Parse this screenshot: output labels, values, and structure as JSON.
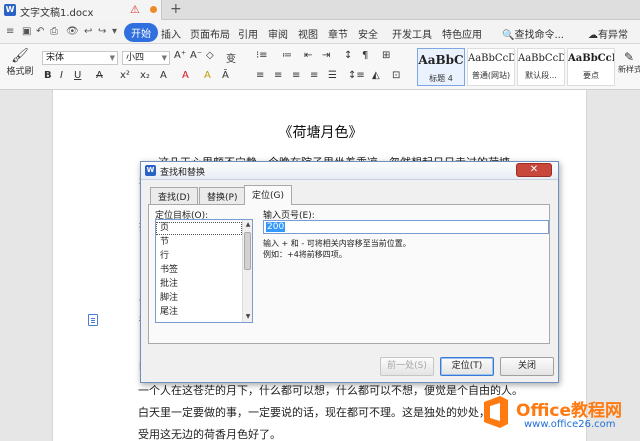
{
  "tabbar": {
    "doc_tab": {
      "icon": "W",
      "title": "文字文稿1.docx",
      "warning_icon": "warning-icon"
    },
    "new_tab_label": "+"
  },
  "menubar": {
    "quick_access": [
      "≡",
      "▣",
      "↶",
      "⎙",
      "👁",
      "↩",
      "↪",
      "▾"
    ],
    "items": [
      "开始",
      "插入",
      "页面布局",
      "引用",
      "审阅",
      "视图",
      "章节",
      "安全",
      "开发工具",
      "特色应用"
    ],
    "active_item": "开始",
    "search_label": "查找命令...",
    "unsaved_label": "有异常"
  },
  "ribbon": {
    "format_painter_label": "格式刷",
    "font_name": "宋体",
    "font_size": "小四",
    "styles": [
      {
        "sample": "AaBbC",
        "caption": "标题 4"
      },
      {
        "sample": "AaBbCcDd",
        "caption": "普通(网站)"
      },
      {
        "sample": "AaBbCcDd",
        "caption": "默认段..."
      },
      {
        "sample": "AaBbCcDd",
        "caption": "要点"
      }
    ],
    "new_style_label": "新样式"
  },
  "document": {
    "title": "《荷塘月色》",
    "lines": [
      "这几天心里颇不宁静。今晚在院子里坐着乘凉，忽然想起日日走过的荷塘",
      "一个人在这苍茫的月下，什么都可以想，什么都可以不想，便觉是个自由的人。",
      "白天里一定要做的事，一定要说的话，现在都可不理。这是独处的妙处，",
      "受用这无边的荷香月色好了。"
    ],
    "partial_chars": [
      "在",
      "拍",
      "曲",
      "一",
      "很",
      "时"
    ]
  },
  "dialog": {
    "title": "查找和替换",
    "close_label": "✕",
    "tabs": [
      "查找(D)",
      "替换(P)",
      "定位(G)"
    ],
    "active_tab": "定位(G)",
    "target_label": "定位目标(O):",
    "targets": [
      "页",
      "节",
      "行",
      "书签",
      "批注",
      "脚注",
      "尾注"
    ],
    "selected_target": "页",
    "page_label": "输入页号(E):",
    "page_value": "200",
    "hint_line1": "输入 + 和 - 可将相关内容移至当前位置。",
    "hint_line2": "例如：+4将前移四项。",
    "buttons": {
      "prev": "前一处(S)",
      "goto": "定位(T)",
      "close": "关闭"
    }
  },
  "watermark": {
    "brand": "Office教程网",
    "url": "www.office26.com"
  },
  "colors": {
    "accent": "#2f6fde",
    "dialog_close": "#c9483c",
    "watermark_orange": "#ff7a10"
  }
}
